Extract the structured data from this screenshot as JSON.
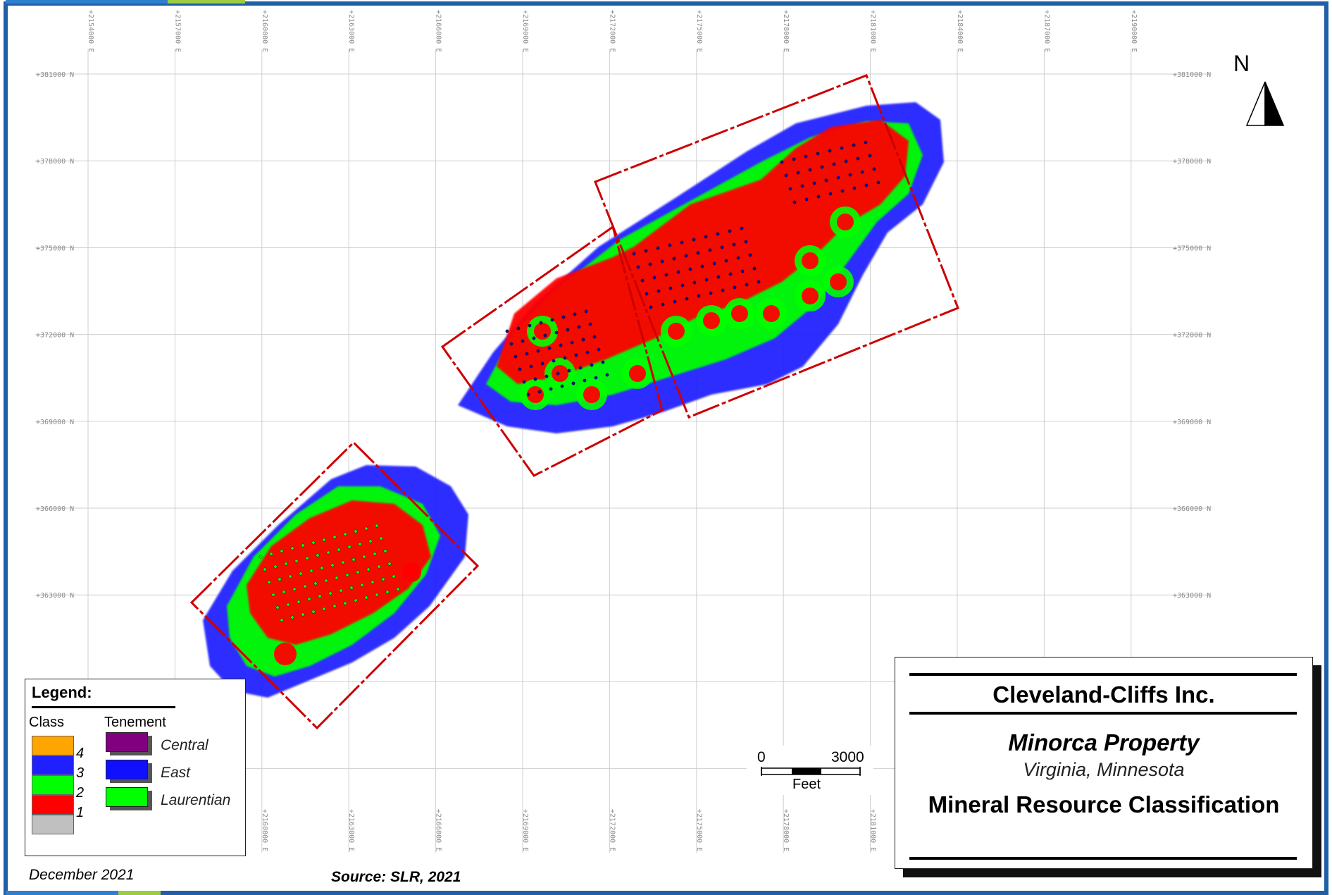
{
  "map": {
    "grid": {
      "eastings": [
        "+2154000 E",
        "+2157000 E",
        "+2160000 E",
        "+2163000 E",
        "+2166000 E",
        "+2169000 E",
        "+2172000 E",
        "+2175000 E",
        "+2178000 E",
        "+2181000 E",
        "+2184000 E",
        "+2187000 E",
        "+2190000 E"
      ],
      "bottom_eastings": [
        "+2160000 E",
        "+2163000 E",
        "+2166000 E",
        "+2169000 E",
        "+2172000 E",
        "+2175000 E",
        "+2178000 E",
        "+2181000 E"
      ],
      "northings": [
        "+381000 N",
        "+378000 N",
        "+375000 N",
        "+372000 N",
        "+369000 N",
        "+366000 N",
        "+363000 N"
      ]
    },
    "colors": {
      "class_4": "#ffa500",
      "class_3": "#2020ff",
      "class_2": "#00ff00",
      "class_1": "#ff0000",
      "class_unclassified": "#c0c0c0",
      "central": "#800080",
      "east": "#1010ff",
      "laurentian": "#00ff00",
      "pit_outline": "#cc0000"
    }
  },
  "legend": {
    "title": "Legend:",
    "class_header": "Class",
    "tenement_header": "Tenement",
    "classes": [
      "4",
      "3",
      "2",
      "1"
    ],
    "tenements": [
      "Central",
      "East",
      "Laurentian"
    ]
  },
  "scale": {
    "start": "0",
    "end": "3000",
    "unit": "Feet"
  },
  "north_arrow": {
    "label": "N"
  },
  "title_block": {
    "company": "Cleveland-Cliffs Inc.",
    "property": "Minorca Property",
    "location": "Virginia, Minnesota",
    "heading": "Mineral Resource Classification"
  },
  "footer": {
    "date": "December 2021",
    "source": "Source: SLR, 2021"
  }
}
